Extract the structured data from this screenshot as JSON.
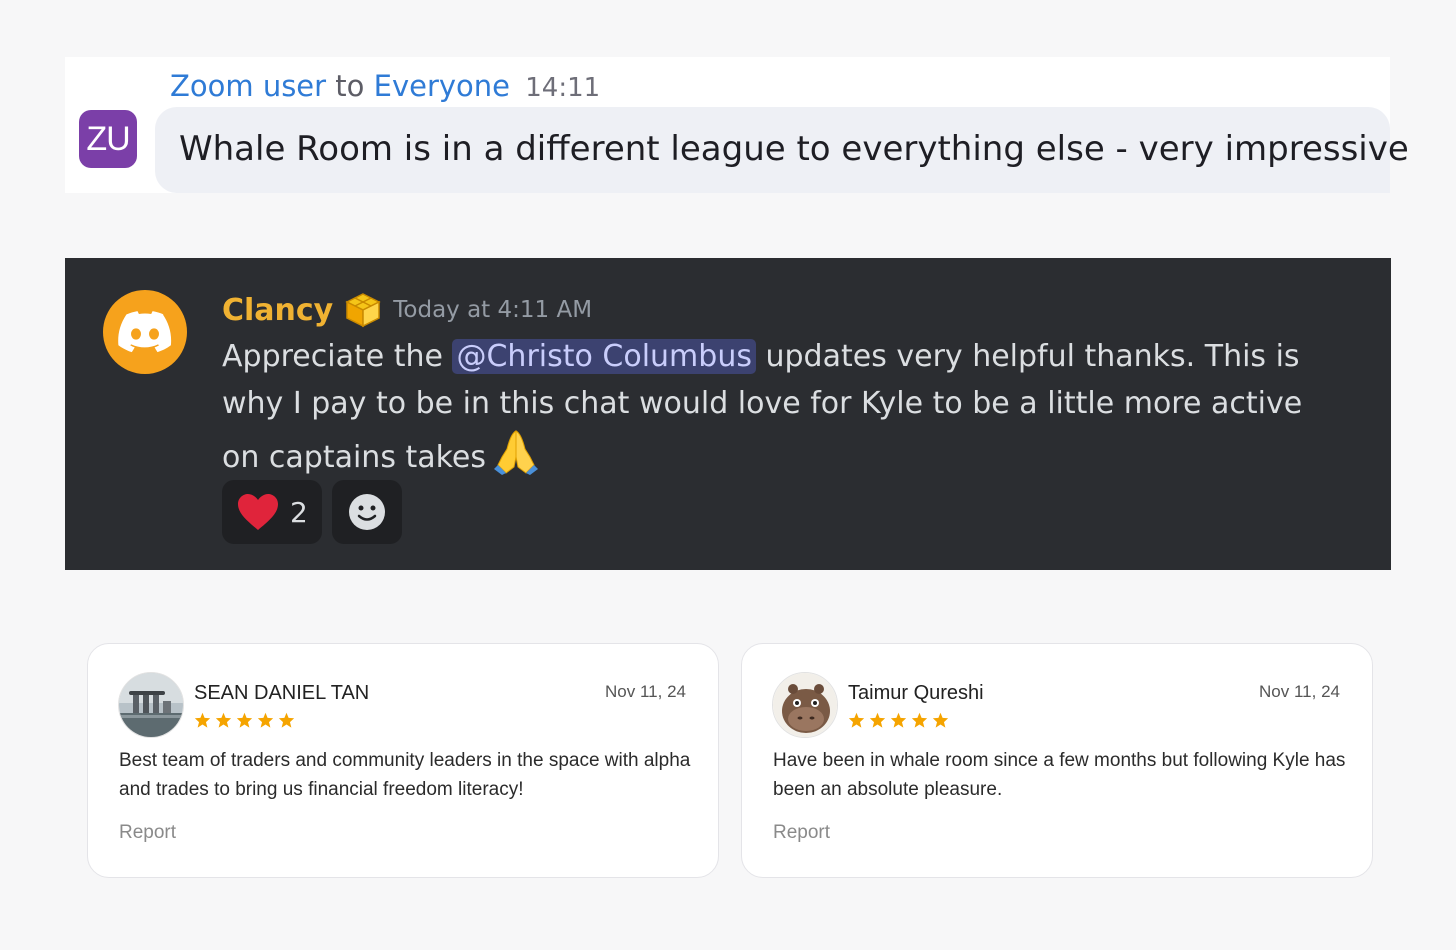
{
  "zoom": {
    "avatar_initials": "ZU",
    "sender": "Zoom user",
    "to_word": "to",
    "recipient": "Everyone",
    "time": "14:11",
    "message": "Whale Room is in a different league to everything else - very impressive",
    "colors": {
      "link": "#2f7bd6",
      "avatar": "#7b3fa8"
    }
  },
  "discord": {
    "username": "Clancy",
    "timestamp": "Today at 4:11 AM",
    "message_lines": [
      {
        "before": "Appreciate the ",
        "mention": "@Christo Columbus",
        "after": " updates very helpful thanks. This is"
      },
      {
        "text": "why I pay to be in this chat would love for Kyle to be a little more active"
      },
      {
        "text": "on captains takes"
      }
    ],
    "reactions": [
      {
        "icon": "heart-icon",
        "count": "2"
      },
      {
        "icon": "add-reaction-icon"
      }
    ],
    "colors": {
      "background": "#2b2d31",
      "username": "#f0b232",
      "avatar": "#f6a21c"
    }
  },
  "reviews": [
    {
      "name": "SEAN DANIEL TAN",
      "date": "Nov 11, 24",
      "rating": 5,
      "text": "Best team of traders and community leaders in the space with alpha and trades to bring us financial freedom literacy!",
      "report_label": "Report"
    },
    {
      "name": "Taimur Qureshi",
      "date": "Nov 11, 24",
      "rating": 5,
      "text": "Have been in whale room since a few months but following Kyle has been an absolute pleasure.",
      "report_label": "Report"
    }
  ]
}
